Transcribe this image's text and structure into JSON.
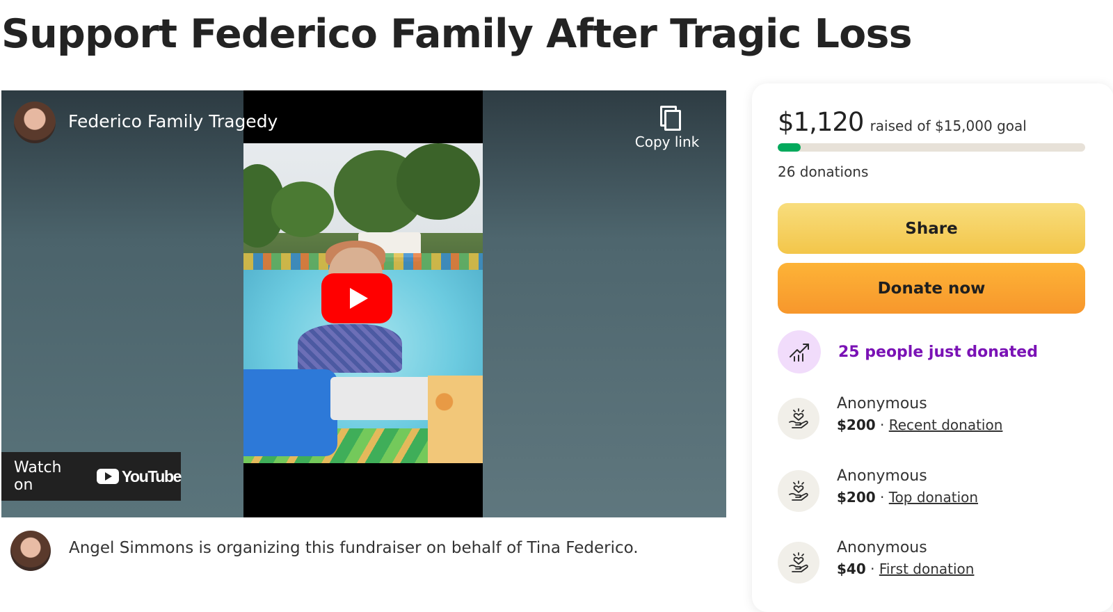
{
  "page": {
    "title": "Support Federico Family After Tragic Loss"
  },
  "video": {
    "title": "Federico Family Tragedy",
    "copy_link_label": "Copy link",
    "watch_on_label": "Watch on",
    "youtube_wordmark": "YouTube",
    "icons": [
      "channel-avatar",
      "copy-icon",
      "play-icon",
      "youtube-logo-icon"
    ]
  },
  "organizer": {
    "text": "Angel Simmons is organizing this fundraiser on behalf of Tina Federico."
  },
  "donation_card": {
    "raised_amount": "$1,120",
    "goal_text": "raised of $15,000 goal",
    "progress_fraction": 0.0747,
    "donations_count": "26 donations",
    "share_label": "Share",
    "donate_label": "Donate now",
    "trend_text": "25 people just donated",
    "trend_icon": "trending-chart-icon",
    "donors": [
      {
        "name": "Anonymous",
        "amount": "$200",
        "separator": " · ",
        "tag": "Recent donation"
      },
      {
        "name": "Anonymous",
        "amount": "$200",
        "separator": " · ",
        "tag": "Top donation"
      },
      {
        "name": "Anonymous",
        "amount": "$40",
        "separator": " · ",
        "tag": "First donation"
      }
    ],
    "donor_icon": "heart-hand-icon"
  },
  "colors": {
    "progress_fill": "#02a95c",
    "progress_track": "#e7e1d8",
    "share_button": "#f3c64a",
    "donate_button": "#f7972c",
    "trend_text": "#7a12b5",
    "trend_badge": "#f1dcfb",
    "youtube_red": "#ff0000"
  }
}
